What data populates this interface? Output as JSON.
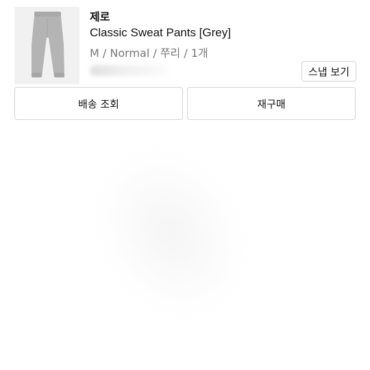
{
  "order_item": {
    "brand": "제로",
    "product_name": "Classic Sweat Pants [Grey]",
    "options": "M / Normal / 쭈리 / 1개",
    "image_icon": "sweatpants-grey-product-image"
  },
  "buttons": {
    "snap": "스냅 보기",
    "track_delivery": "배송 조회",
    "reorder": "재구매"
  },
  "colors": {
    "text_primary": "#111111",
    "text_secondary": "#777777",
    "border": "#d4d4d4",
    "pants_grey": "#b4b4b4"
  }
}
